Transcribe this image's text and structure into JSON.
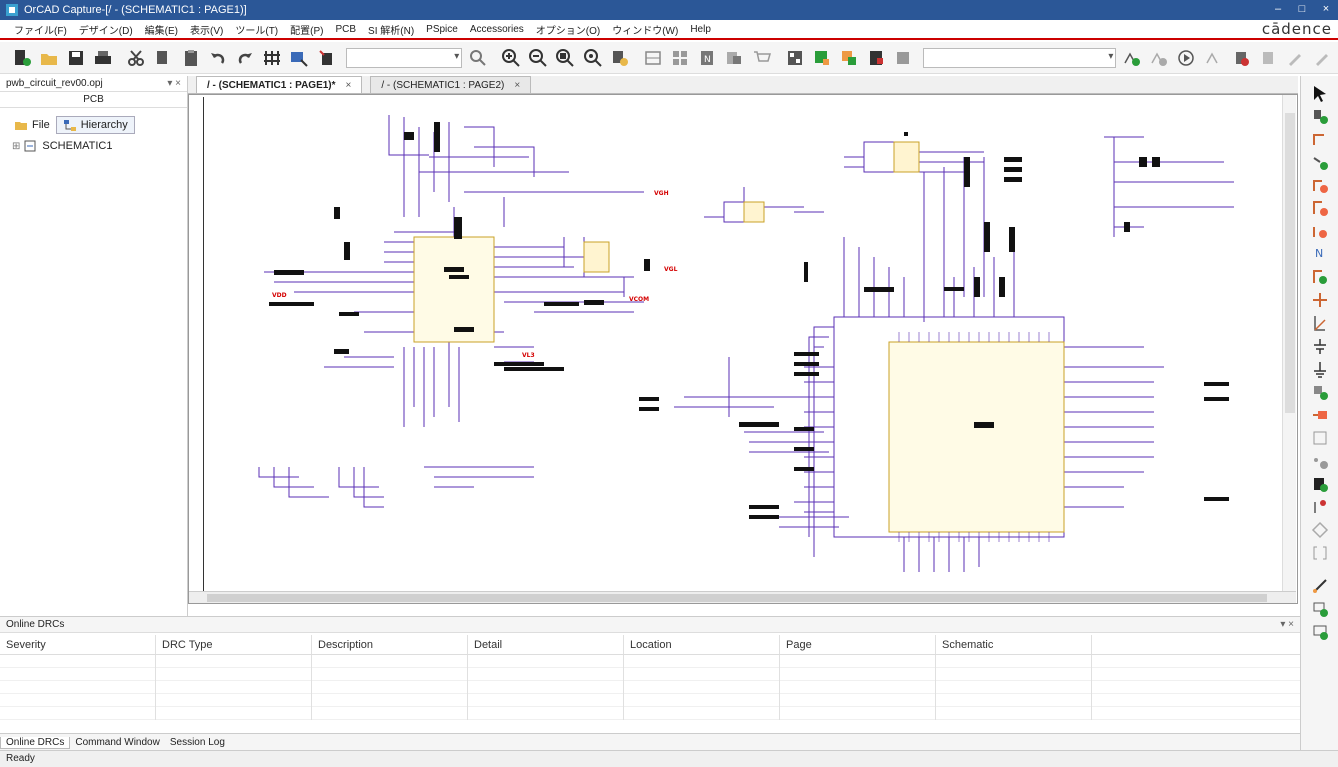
{
  "window": {
    "title": "OrCAD Capture-[/ - (SCHEMATIC1 : PAGE1)]",
    "minimize": "‒",
    "maximize": "□",
    "close": "×"
  },
  "menu": {
    "items": [
      "ファイル(F)",
      "デザイン(D)",
      "編集(E)",
      "表示(V)",
      "ツール(T)",
      "配置(P)",
      "PCB",
      "SI 解析(N)",
      "PSpice",
      "Accessories",
      "オプション(O)",
      "ウィンドウ(W)",
      "Help"
    ],
    "logo": "cādence"
  },
  "toolbar": {
    "icons": [
      "new-part-icon",
      "open-folder-icon",
      "save-icon",
      "print-icon",
      "cut-icon",
      "copy-icon",
      "paste-icon",
      "undo-icon",
      "redo-icon",
      "annotate-icon",
      "select-icon",
      "part-icon"
    ],
    "zoom_icons": [
      "zoom-in-icon",
      "zoom-out-icon",
      "zoom-area-icon",
      "zoom-all-icon",
      "zoom-selection-icon"
    ]
  },
  "project": {
    "filename": "pwb_circuit_rev00.opj",
    "pcb_label": "PCB",
    "tab_file": "File",
    "tab_hierarchy": "Hierarchy",
    "tree_node": "SCHEMATIC1",
    "expand_symbol": "⊞"
  },
  "doc_tabs": [
    {
      "label": "/ - (SCHEMATIC1 : PAGE1)*"
    },
    {
      "label": "/ - (SCHEMATIC1 : PAGE2)"
    }
  ],
  "drc": {
    "pane_title": "Online DRCs",
    "columns": [
      "Severity",
      "DRC Type",
      "Description",
      "Detail",
      "Location",
      "Page",
      "Schematic"
    ],
    "bottom_tabs": [
      "Online DRCs",
      "Command Window",
      "Session Log"
    ]
  },
  "status": "Ready",
  "schematic_labels": {
    "vdd": "VDD",
    "vgh": "VGH",
    "vgl": "VGL",
    "vcom": "VCOM",
    "vl3": "VL3"
  },
  "colors": {
    "wire": "#5a2fb5",
    "net_red": "#d40000",
    "title_bg": "#2b5797",
    "accent": "#c00000"
  }
}
